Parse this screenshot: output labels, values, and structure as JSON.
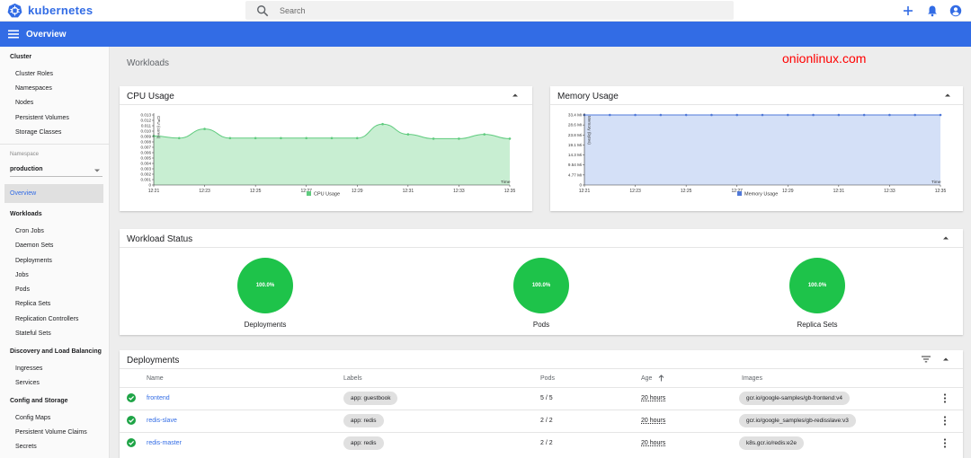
{
  "app": {
    "name": "kubernetes"
  },
  "search": {
    "placeholder": "Search"
  },
  "header": {
    "title": "Overview"
  },
  "sidebar": {
    "cluster": {
      "title": "Cluster",
      "items": [
        "Cluster Roles",
        "Namespaces",
        "Nodes",
        "Persistent Volumes",
        "Storage Classes"
      ]
    },
    "namespace": {
      "label": "Namespace",
      "selected": "production"
    },
    "overview": "Overview",
    "workloads": {
      "title": "Workloads",
      "items": [
        "Cron Jobs",
        "Daemon Sets",
        "Deployments",
        "Jobs",
        "Pods",
        "Replica Sets",
        "Replication Controllers",
        "Stateful Sets"
      ]
    },
    "discovery": {
      "title": "Discovery and Load Balancing",
      "items": [
        "Ingresses",
        "Services"
      ]
    },
    "config": {
      "title": "Config and Storage",
      "items": [
        "Config Maps",
        "Persistent Volume Claims",
        "Secrets"
      ]
    }
  },
  "main": {
    "page_title": "Workloads",
    "watermark": "onionlinux.com",
    "status_card_title": "Workload Status",
    "status": [
      {
        "label": "Deployments",
        "value": "100.0%"
      },
      {
        "label": "Pods",
        "value": "100.0%"
      },
      {
        "label": "Replica Sets",
        "value": "100.0%"
      }
    ],
    "deployments": {
      "title": "Deployments",
      "columns": [
        "Name",
        "Labels",
        "Pods",
        "Age",
        "Images"
      ],
      "rows": [
        {
          "name": "frontend",
          "label": "app: guestbook",
          "pods": "5 / 5",
          "age": "20 hours",
          "image": "gcr.io/google-samples/gb-frontend:v4"
        },
        {
          "name": "redis-slave",
          "label": "app: redis",
          "pods": "2 / 2",
          "age": "20 hours",
          "image": "gcr.io/google_samples/gb-redisslave:v3"
        },
        {
          "name": "redis-master",
          "label": "app: redis",
          "pods": "2 / 2",
          "age": "20 hours",
          "image": "k8s.gcr.io/redis:e2e"
        }
      ]
    }
  },
  "colors": {
    "brand": "#326ce5",
    "success": "#1ec34a",
    "cpu_fill": "#c8eed2",
    "cpu_line": "#5fcb7e",
    "mem_fill": "#d4e0f7",
    "mem_line": "#4f78d8"
  },
  "chart_data": [
    {
      "type": "area",
      "title": "CPU Usage",
      "ylabel": "CPU (cores)",
      "xlabel": "Time",
      "x": [
        "12:21",
        "12:22",
        "12:23",
        "12:24",
        "12:25",
        "12:26",
        "12:27",
        "12:28",
        "12:29",
        "12:30",
        "12:31",
        "12:32",
        "12:33",
        "12:34",
        "12:35"
      ],
      "xticks": [
        "12:21",
        "12:23",
        "12:25",
        "12:27",
        "12:29",
        "12:31",
        "12:33",
        "12:35"
      ],
      "yticks": [
        "0.013",
        "0.012",
        "0.011",
        "0.010",
        "0.009",
        "0.008",
        "0.007",
        "0.006",
        "0.005",
        "0.004",
        "0.003",
        "0.002",
        "0.001",
        "0"
      ],
      "ylim": [
        0,
        0.013
      ],
      "series": [
        {
          "name": "CPU Usage",
          "values": [
            0.0091,
            0.0087,
            0.0104,
            0.0087,
            0.0087,
            0.0087,
            0.0087,
            0.0087,
            0.0087,
            0.0113,
            0.0094,
            0.0086,
            0.0086,
            0.0094,
            0.0086
          ]
        }
      ]
    },
    {
      "type": "area",
      "title": "Memory Usage",
      "ylabel": "Memory (bytes)",
      "xlabel": "Time",
      "x": [
        "12:21",
        "12:22",
        "12:23",
        "12:24",
        "12:25",
        "12:26",
        "12:27",
        "12:28",
        "12:29",
        "12:30",
        "12:31",
        "12:32",
        "12:33",
        "12:34",
        "12:35"
      ],
      "xticks": [
        "12:21",
        "12:23",
        "12:25",
        "12:27",
        "12:29",
        "12:31",
        "12:33",
        "12:35"
      ],
      "yticks": [
        "33.4 Mi",
        "28.6 Mi",
        "23.8 Mi",
        "19.1 Mi",
        "14.3 Mi",
        "9.54 Mi",
        "4.77 Mi",
        "0"
      ],
      "ylim": [
        0,
        33.4
      ],
      "series": [
        {
          "name": "Memory Usage",
          "values": [
            33.4,
            33.4,
            33.4,
            33.4,
            33.4,
            33.4,
            33.4,
            33.4,
            33.4,
            33.4,
            33.4,
            33.4,
            33.4,
            33.4,
            33.4
          ]
        }
      ]
    }
  ]
}
